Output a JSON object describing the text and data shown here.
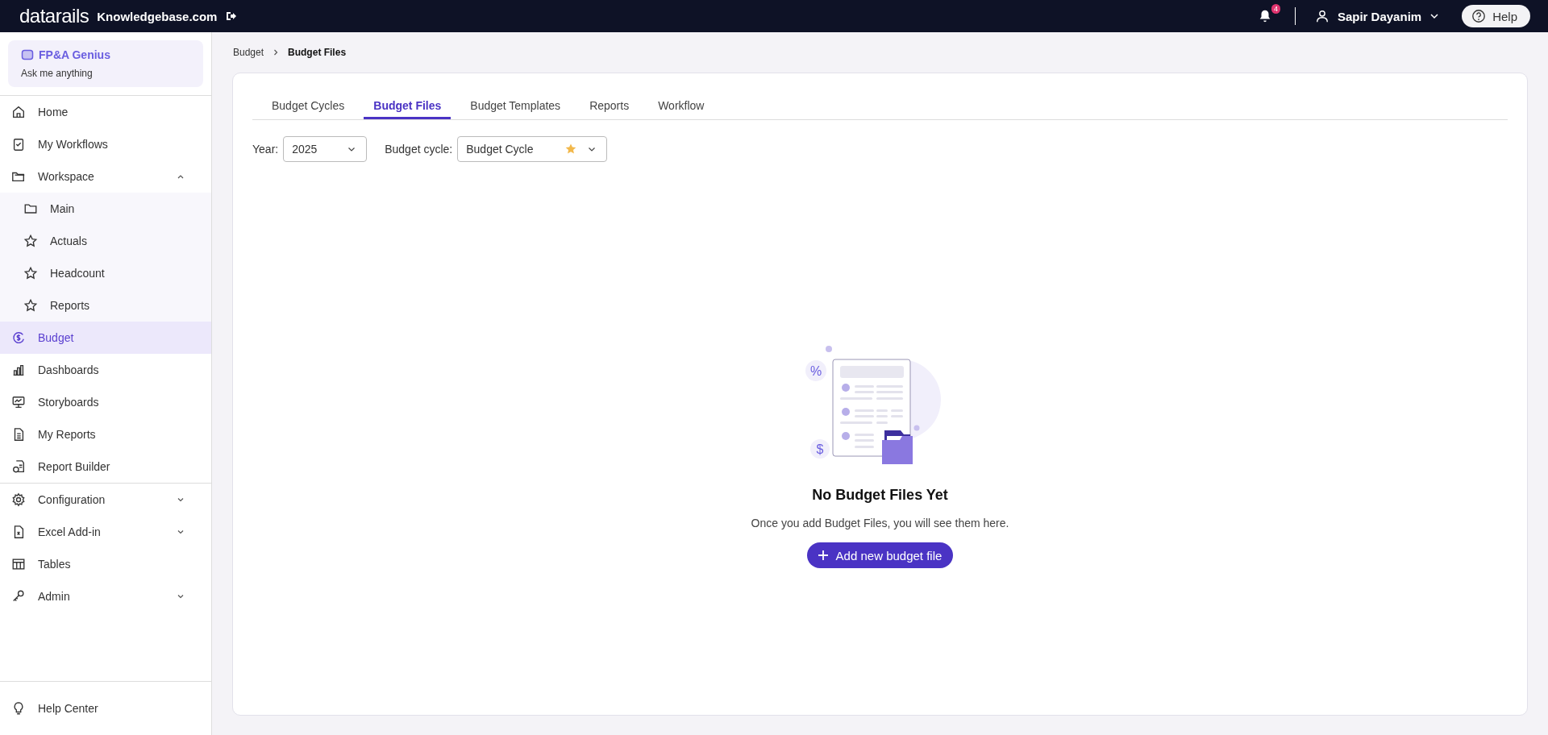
{
  "topbar": {
    "logo": "datarails",
    "site": "Knowledgebase.com",
    "notifications": "4",
    "user": "Sapir Dayanim",
    "help": "Help"
  },
  "genius": {
    "title": "FP&A Genius",
    "subtitle": "Ask me anything"
  },
  "sidebar": {
    "groups": [
      {
        "items": [
          {
            "label": "Home",
            "selected": false
          },
          {
            "label": "My Workflows",
            "selected": false
          },
          {
            "label": "Workspace",
            "selected": false,
            "expanded": true,
            "children": [
              {
                "label": "Main",
                "selected": false
              },
              {
                "label": "Actuals",
                "selected": false
              },
              {
                "label": "Headcount",
                "selected": false
              },
              {
                "label": "Reports",
                "selected": false
              }
            ]
          },
          {
            "label": "Budget",
            "selected": true
          },
          {
            "label": "Dashboards",
            "selected": false
          },
          {
            "label": "Storyboards",
            "selected": false
          },
          {
            "label": "My Reports",
            "selected": false
          },
          {
            "label": "Report Builder",
            "selected": false
          }
        ]
      },
      {
        "items": [
          {
            "label": "Configuration",
            "selected": false,
            "expanded": false
          },
          {
            "label": "Excel Add-in",
            "selected": false,
            "expanded": false
          },
          {
            "label": "Tables",
            "selected": false
          },
          {
            "label": "Admin",
            "selected": false,
            "expanded": false
          }
        ]
      }
    ],
    "footer": {
      "label": "Help Center"
    }
  },
  "breadcrumb": [
    "Budget",
    "Budget Files"
  ],
  "tabs": [
    {
      "label": "Budget Cycles",
      "selected": false
    },
    {
      "label": "Budget Files",
      "selected": true
    },
    {
      "label": "Budget Templates",
      "selected": false
    },
    {
      "label": "Reports",
      "selected": false
    },
    {
      "label": "Workflow",
      "selected": false
    }
  ],
  "filters": [
    {
      "label": "Year:",
      "value": "2025",
      "favorite": false
    },
    {
      "label": "Budget cycle:",
      "value": "Budget Cycle",
      "favorite": true
    }
  ],
  "empty_state": {
    "title": "No Budget Files Yet",
    "message": "Once you add Budget Files, you will see them here.",
    "button": "Add new budget file",
    "symbols": [
      "%",
      "$"
    ]
  }
}
